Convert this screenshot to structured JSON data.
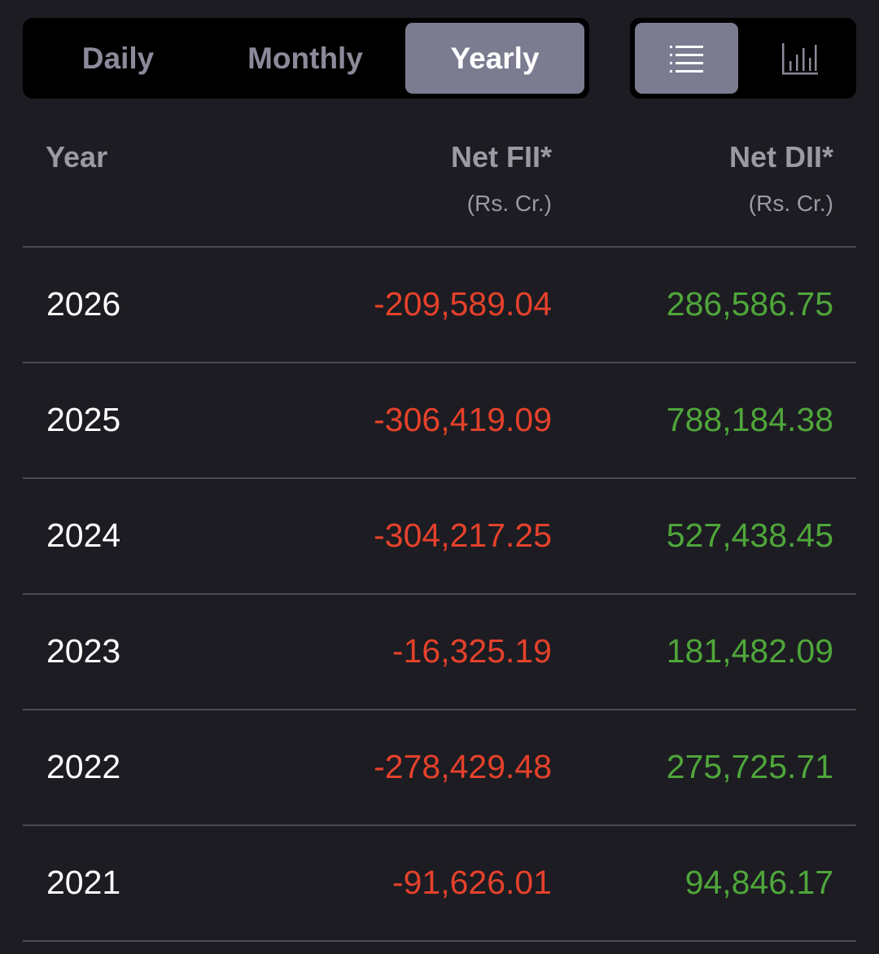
{
  "period_tabs": [
    {
      "label": "Daily",
      "active": false
    },
    {
      "label": "Monthly",
      "active": false
    },
    {
      "label": "Yearly",
      "active": true
    }
  ],
  "view_toggle": {
    "list": {
      "icon": "list-icon",
      "active": true
    },
    "chart": {
      "icon": "bar-chart-icon",
      "active": false
    }
  },
  "table": {
    "headers": {
      "year": "Year",
      "fii": "Net FII*",
      "fii_unit": "(Rs. Cr.)",
      "dii": "Net DII*",
      "dii_unit": "(Rs. Cr.)"
    },
    "rows": [
      {
        "year": "2026",
        "fii": "-209,589.04",
        "dii": "286,586.75"
      },
      {
        "year": "2025",
        "fii": "-306,419.09",
        "dii": "788,184.38"
      },
      {
        "year": "2024",
        "fii": "-304,217.25",
        "dii": "527,438.45"
      },
      {
        "year": "2023",
        "fii": "-16,325.19",
        "dii": "181,482.09"
      },
      {
        "year": "2022",
        "fii": "-278,429.48",
        "dii": "275,725.71"
      },
      {
        "year": "2021",
        "fii": "-91,626.01",
        "dii": "94,846.17"
      }
    ]
  },
  "colors": {
    "background": "#1c1c22",
    "negative": "#e5412b",
    "positive": "#4fa63a",
    "active_tab": "#7b7c90"
  }
}
